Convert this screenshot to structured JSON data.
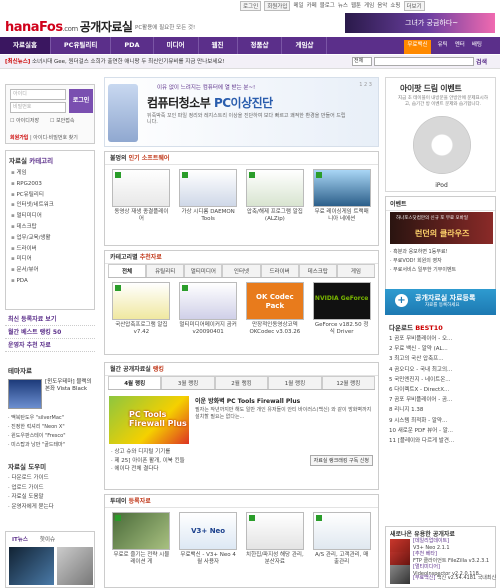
{
  "top_links": [
    "로그인",
    "회원가입",
    "메일",
    "카페",
    "블로그",
    "뉴스",
    "웹툰",
    "게임",
    "음악",
    "쇼핑",
    "더보기"
  ],
  "logo": {
    "brand": "hanaFos",
    "domain": ".com",
    "title": "공개자료실"
  },
  "slogan": "PC활용에 필요한 모든 것!",
  "top_banner": "그녀가 궁금하다~",
  "main_nav": [
    "자료실홈",
    "PC유틸리티",
    "PDA",
    "미디어",
    "웹진",
    "정품샵",
    "게임샵"
  ],
  "main_nav_right": [
    "무료백신",
    "유틱",
    "엔터",
    "배팅"
  ],
  "notice": {
    "tag": "[최신뉴스]",
    "text": "소녀시대 Gee, 원더걸스 소희가 출연한 애니팡 두 최신인기뮤비를 지금 만나보세요!"
  },
  "search": {
    "select": "전체",
    "button": "검색"
  },
  "login": {
    "id_placeholder": "아이디",
    "pw_placeholder": "비밀번호",
    "button": "로그인",
    "save_id": "아이디저장",
    "secure": "보안접속",
    "join": "회원가입",
    "find": "아이디·비밀번호 찾기"
  },
  "category": {
    "title_a": "자료실",
    "title_b": "카테고리",
    "items": [
      "게임",
      "RPG2003",
      "PC유틸리티",
      "인터넷/네트워크",
      "멀티미디어",
      "데스크탑",
      "업무/교육/생활",
      "드라이버",
      "미디어",
      "문서/뷰어",
      "PDA"
    ]
  },
  "left_links": [
    "최신 등록자료 보기",
    "월간 베스트 랭킹 50",
    "운영자 추천 자료"
  ],
  "theme": {
    "title": "테마자료",
    "caption": "[윈도우테마] 블랙의 본좌 Vista Black",
    "items": [
      "· 맥북탄도우 \"silverMac\"",
      "· 진정한 럭셔리 \"Neon X\"",
      "· 윈도우판스테이 \"Fresco\"",
      "· 미스탑과 낭만 \"골드테마\""
    ]
  },
  "help": {
    "title": "자료실 도우미",
    "items": [
      "· 다운로드 가이드",
      "· 업로드 가이드",
      "· 자료실 도움말",
      "· 운영자에게 묻는다"
    ]
  },
  "news": {
    "tab1": "IT뉴스",
    "tab2": "핫이슈"
  },
  "hero": {
    "line1": "이유 없이 느려지는 컴퓨터에 열 받는 분~!",
    "line2a": "컴퓨터청소부",
    "line2b": "PC이상진단",
    "line3": "뒤죽박죽 꼬인 파일 정리와 레지스트리 이상을 진단하여 보다 빠르고 쾌적한 환경을 만들어 드립니다.",
    "nav": "1 2 3"
  },
  "popular": {
    "title_a": "불멍의",
    "title_b": "인기 소프트웨어",
    "items": [
      "동영상 재생 종결플레이어",
      "가상 시디롬 DAEMON Tools",
      "압축/해제 프로그램 알집(ALZip)",
      "무료 레이싱게임 트랙매니아 네에션"
    ]
  },
  "recommend": {
    "title_a": "카테고리별",
    "title_b": "추천자료",
    "tabs": [
      "전체",
      "유틸리티",
      "멀티미디어",
      "인터넷",
      "드라이버",
      "데스크탑",
      "게임"
    ],
    "items": [
      "국산압축프로그램 알집 v7.42",
      "멀티미디어메이커지 곰커 v20090401",
      "만장적인동영상코덱 OKCodec v3.03.26",
      "GeForce v182.50 정식 Driver"
    ],
    "codec_label": "OK Codec Pack",
    "nvidia_label": "NVIDIA GeForce"
  },
  "ranking": {
    "title_a": "월간 공개자료실",
    "title_b": "랭킹",
    "tabs": [
      "4월 랭킹",
      "3월 랭킹",
      "2월 랭킹",
      "1월 랭킹",
      "12월 랭킹"
    ],
    "feature_img": "PC Tools Firewall Plus",
    "feature_title": "이운 방화벽 PC Tools Firewall Plus",
    "feature_desc": "필자는 작년까지만 해도 일반 개인 유저들이 안티 바이러스(백신) 와 같이 방화벽까지 설치할 필요는 없다는...",
    "items": [
      "· 상고 슈와 디지털 기기를",
      "· 제 25] 아이폰 활개, 이북 킨들",
      "· 에이다 전체 결다다"
    ],
    "more": "자료실 랭크래킹 구독 신청"
  },
  "today": {
    "title_a": "투데이",
    "title_b": "등록자료",
    "items": [
      "무료로 즐기는 전략 시뮬레이션 게",
      "무료백신 - V3+ Neo 4월 사용자",
      "치한집/파지성 해당 관리, 분산자료",
      "A/S 관리, 고객관리, 매출관리"
    ],
    "badge": "V3+ Neo"
  },
  "ipod": {
    "title": "아이팟 드림 이벤트",
    "desc": "지금 초 테이블이 내방문을 안방안에 문제표시하고, 습기간 방 이벤트 문제와 습기합니다.",
    "caption": "iPod"
  },
  "event": {
    "title": "이벤트",
    "banner_top": "하나포스닷컴만의 신규 포 무료 모바일",
    "banner": "런던의 클라우즈",
    "items": [
      "· 흑분과 응모하면 1등무료!",
      "· 무료VOD! 회원의 영자",
      "· 무료서비스 일부한 기부이벤트"
    ]
  },
  "register": {
    "title": "공개자료실 자료등록",
    "sub": "자료를 등록하세요"
  },
  "best": {
    "title_a": "다운로드",
    "title_b": "BEST10",
    "items": [
      "1 곰포 무비플레이어 - 오...",
      "2 무료 백신 - 알약 (AL...",
      "3 최고의 국산 압축프...",
      "4 곰오디오 - 국내 최고의...",
      "5 국민엔진지 - 네이트온...",
      "6 다이렉트X - DirectX...",
      "7 곰포 무비플레이어 - 곰...",
      "8 리니지 1.38",
      "9 시스템 최적화 - 알약...",
      "10 새로운 PDF 뷰어 - 알...",
      "11 [플레이와 다르게 발견..."
    ]
  },
  "new_section": {
    "title": "새로나온 유용한 공개자료",
    "rows": [
      {
        "cat": "[데일리업데이트]",
        "name": "V3+ Neo",
        "meta": "2.1.1"
      },
      {
        "cat": "[추천 베타]",
        "name": "FTP 클라이언트",
        "meta": "FileZilla v3.2.3.1"
      },
      {
        "cat": "[멀티미디어]",
        "name": "VideoInspector",
        "meta": "v2.2.0.118"
      },
      {
        "cat": "[무료백신]",
        "name": "백신 v2.54.4181",
        "meta": "국내최신"
      }
    ]
  },
  "colors": {
    "nav": "#5b2f8a",
    "accent": "#c0391b",
    "brand": "#d0021b"
  }
}
